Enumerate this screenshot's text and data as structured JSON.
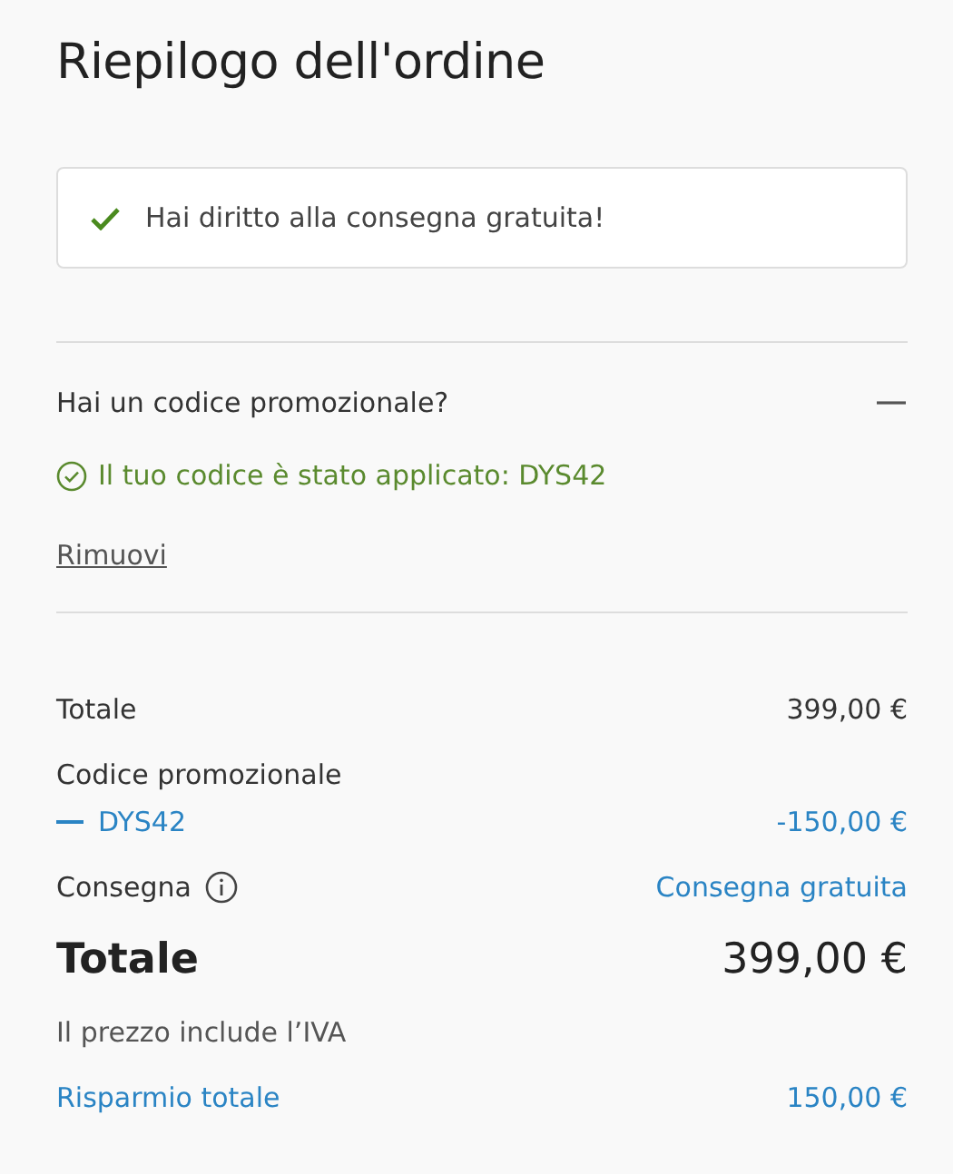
{
  "title": "Riepilogo dell'ordine",
  "notice": {
    "text": "Hai diritto alla consegna gratuita!"
  },
  "promo": {
    "question": "Hai un codice promozionale?",
    "expanded": true,
    "applied": "Il tuo codice è stato applicato: DYS42",
    "remove": "Rimuovi"
  },
  "summary": {
    "subtotal": {
      "label": "Totale",
      "value": "399,00 €"
    },
    "promo_label": "Codice promozionale",
    "promo_code": "DYS42",
    "promo_value": "-150,00 €",
    "delivery": {
      "label": "Consegna",
      "value": "Consegna gratuita"
    },
    "total": {
      "label": "Totale",
      "value": "399,00 €"
    },
    "vat_note": "Il prezzo include l’IVA",
    "savings": {
      "label": "Risparmio totale",
      "value": "150,00 €"
    }
  }
}
